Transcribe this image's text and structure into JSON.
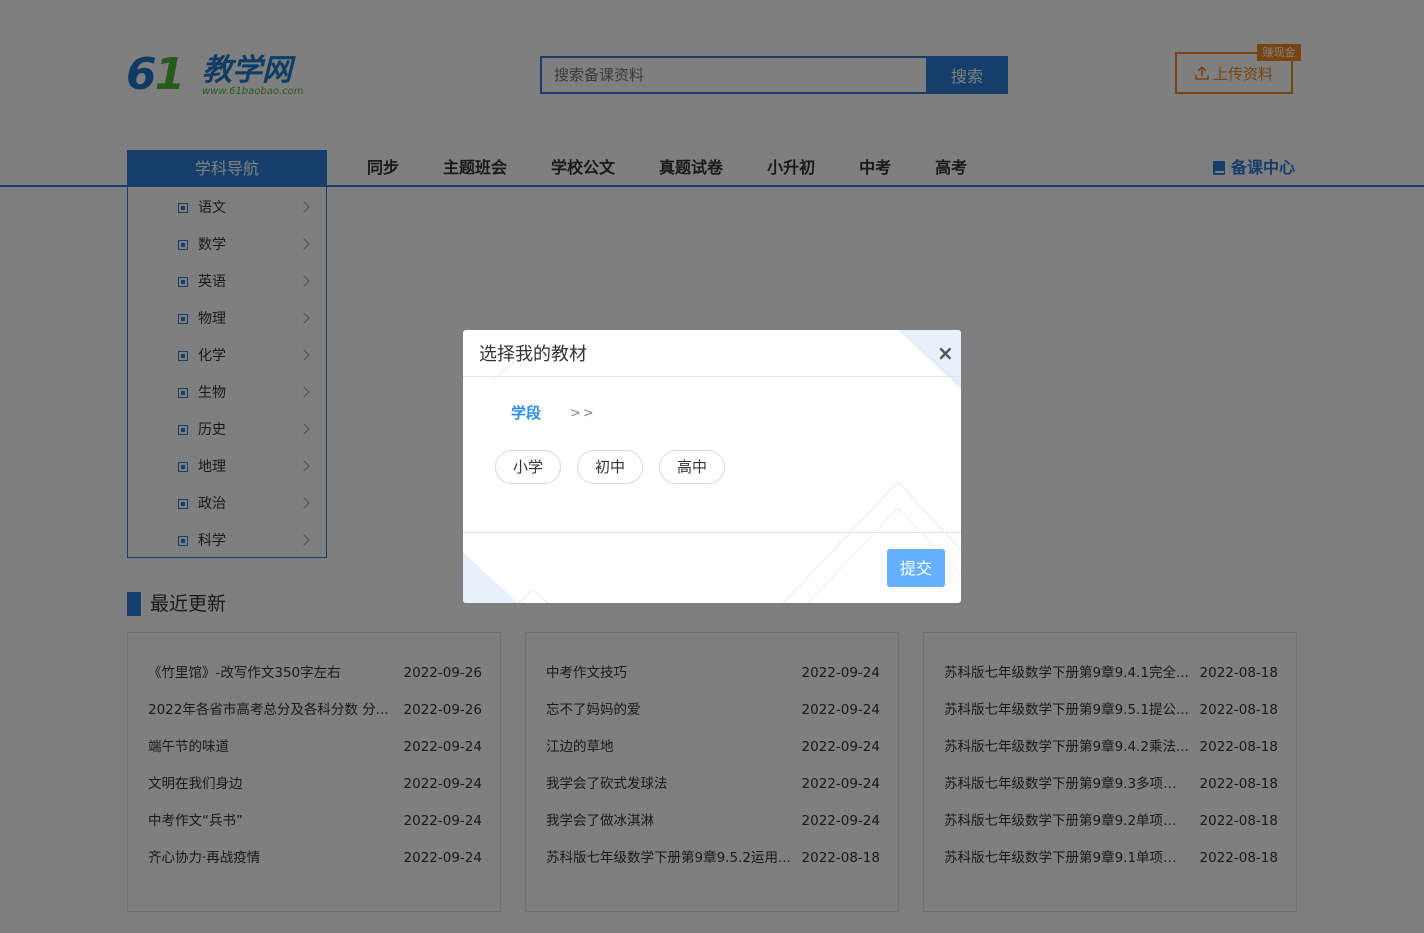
{
  "header": {
    "logo": {
      "number": "61",
      "text": "教学网",
      "url": "www.61baobao.com"
    },
    "search": {
      "placeholder": "搜索备课资料",
      "button_label": "搜索"
    },
    "upload": {
      "label": "上传资料",
      "badge": "赚现金"
    }
  },
  "nav": {
    "subject_nav_label": "学科导航",
    "items": [
      "同步",
      "主题班会",
      "学校公文",
      "真题试卷",
      "小升初",
      "中考",
      "高考"
    ],
    "prep_center": "备课中心"
  },
  "subjects": [
    "语文",
    "数学",
    "英语",
    "物理",
    "化学",
    "生物",
    "历史",
    "地理",
    "政治",
    "科学"
  ],
  "recent": {
    "title": "最近更新",
    "columns": [
      [
        {
          "title": "《竹里馆》-改写作文350字左右",
          "date": "2022-09-26"
        },
        {
          "title": "2022年各省市高考总分及各科分数 分...",
          "date": "2022-09-26"
        },
        {
          "title": "端午节的味道",
          "date": "2022-09-24"
        },
        {
          "title": "文明在我们身边",
          "date": "2022-09-24"
        },
        {
          "title": "中考作文“兵书”",
          "date": "2022-09-24"
        },
        {
          "title": "齐心协力·再战疫情",
          "date": "2022-09-24"
        }
      ],
      [
        {
          "title": "中考作文技巧",
          "date": "2022-09-24"
        },
        {
          "title": "忘不了妈妈的爱",
          "date": "2022-09-24"
        },
        {
          "title": "江边的草地",
          "date": "2022-09-24"
        },
        {
          "title": "我学会了砍式发球法",
          "date": "2022-09-24"
        },
        {
          "title": "我学会了做冰淇淋",
          "date": "2022-09-24"
        },
        {
          "title": "苏科版七年级数学下册第9章9.5.2运用...",
          "date": "2022-08-18"
        }
      ],
      [
        {
          "title": "苏科版七年级数学下册第9章9.4.1完全...",
          "date": "2022-08-18"
        },
        {
          "title": "苏科版七年级数学下册第9章9.5.1提公...",
          "date": "2022-08-18"
        },
        {
          "title": "苏科版七年级数学下册第9章9.4.2乘法...",
          "date": "2022-08-18"
        },
        {
          "title": "苏科版七年级数学下册第9章9.3多项式...",
          "date": "2022-08-18"
        },
        {
          "title": "苏科版七年级数学下册第9章9.2单项式...",
          "date": "2022-08-18"
        },
        {
          "title": "苏科版七年级数学下册第9章9.1单项式...",
          "date": "2022-08-18"
        }
      ]
    ]
  },
  "modal": {
    "title": "选择我的教材",
    "close": "×",
    "stage_tab": "学段",
    "separator": ">>",
    "options": [
      "小学",
      "初中",
      "高中"
    ],
    "submit_label": "提交"
  },
  "colors": {
    "primary": "#2a7fd4",
    "accent": "#f08a24",
    "submit": "#66b1ff",
    "overlay": "rgba(0,0,0,0.5)"
  }
}
